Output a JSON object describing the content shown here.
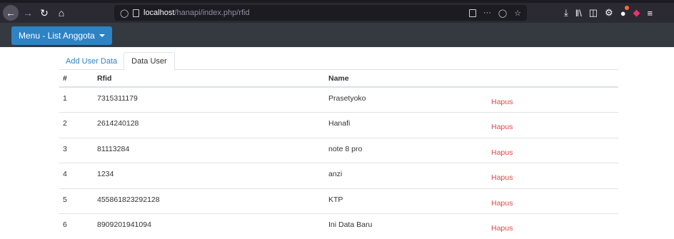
{
  "browser": {
    "url_host": "localhost",
    "url_path": "/hanapi/index.php/rfid",
    "icons": [
      "back-arrow-icon",
      "forward-arrow-icon",
      "reload-icon",
      "home-icon",
      "shield-icon",
      "page-icon",
      "reader-view-icon",
      "more-icon",
      "pocket-icon",
      "bookmark-star-icon",
      "download-icon",
      "library-icon",
      "sidebar-icon",
      "extension-icon",
      "extension-icon",
      "extension-icon",
      "menu-icon"
    ]
  },
  "navbar": {
    "menu_label": "Menu - List Anggota"
  },
  "tabs": [
    {
      "label": "Add User Data",
      "active": false
    },
    {
      "label": "Data User",
      "active": true
    }
  ],
  "table": {
    "headers": [
      "#",
      "Rfid",
      "Name",
      ""
    ],
    "rows": [
      {
        "num": "1",
        "rfid": "7315311179",
        "name": "Prasetyoko",
        "action": "Hapus"
      },
      {
        "num": "2",
        "rfid": "2614240128",
        "name": "Hanafi",
        "action": "Hapus"
      },
      {
        "num": "3",
        "rfid": "81113284",
        "name": "note 8 pro",
        "action": "Hapus"
      },
      {
        "num": "4",
        "rfid": "1234",
        "name": "anzi",
        "action": "Hapus"
      },
      {
        "num": "5",
        "rfid": "455861823292128",
        "name": "KTP",
        "action": "Hapus"
      },
      {
        "num": "6",
        "rfid": "8909201941094",
        "name": "Ini Data Baru",
        "action": "Hapus"
      }
    ]
  },
  "colors": {
    "navbar_bg": "#343a40",
    "menu_button": "#2d83c4",
    "link": "#2d83c4",
    "delete_link": "#e04848",
    "browser_bg": "#2b2a33"
  }
}
